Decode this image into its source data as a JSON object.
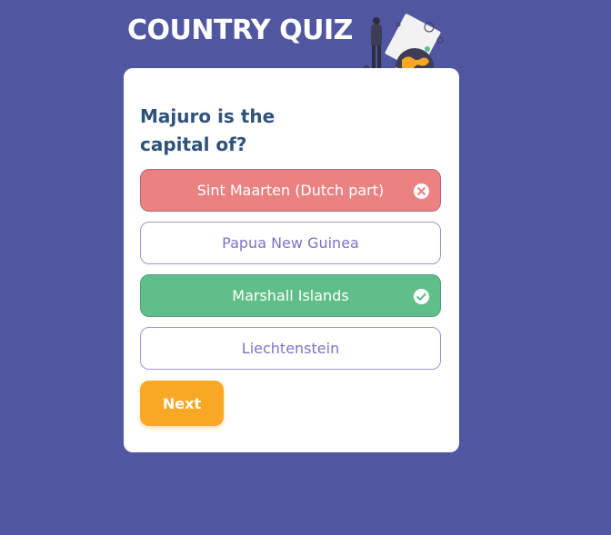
{
  "header": {
    "title": "COUNTRY QUIZ"
  },
  "question": {
    "text": "Majuro is the capital of?"
  },
  "options": [
    {
      "label": "Sint Maarten (Dutch part)",
      "state": "wrong",
      "icon": "x-circle-icon"
    },
    {
      "label": "Papua New Guinea",
      "state": "neutral"
    },
    {
      "label": "Marshall Islands",
      "state": "correct",
      "icon": "check-circle-icon"
    },
    {
      "label": "Liechtenstein",
      "state": "neutral"
    }
  ],
  "actions": {
    "next_label": "Next"
  },
  "colors": {
    "background": "#5056A0",
    "card": "#FFFFFF",
    "question_text": "#2F527B",
    "option_text": "#7A74C9",
    "wrong": "#EA8282",
    "correct": "#60BF88",
    "next_button": "#F9A826"
  }
}
